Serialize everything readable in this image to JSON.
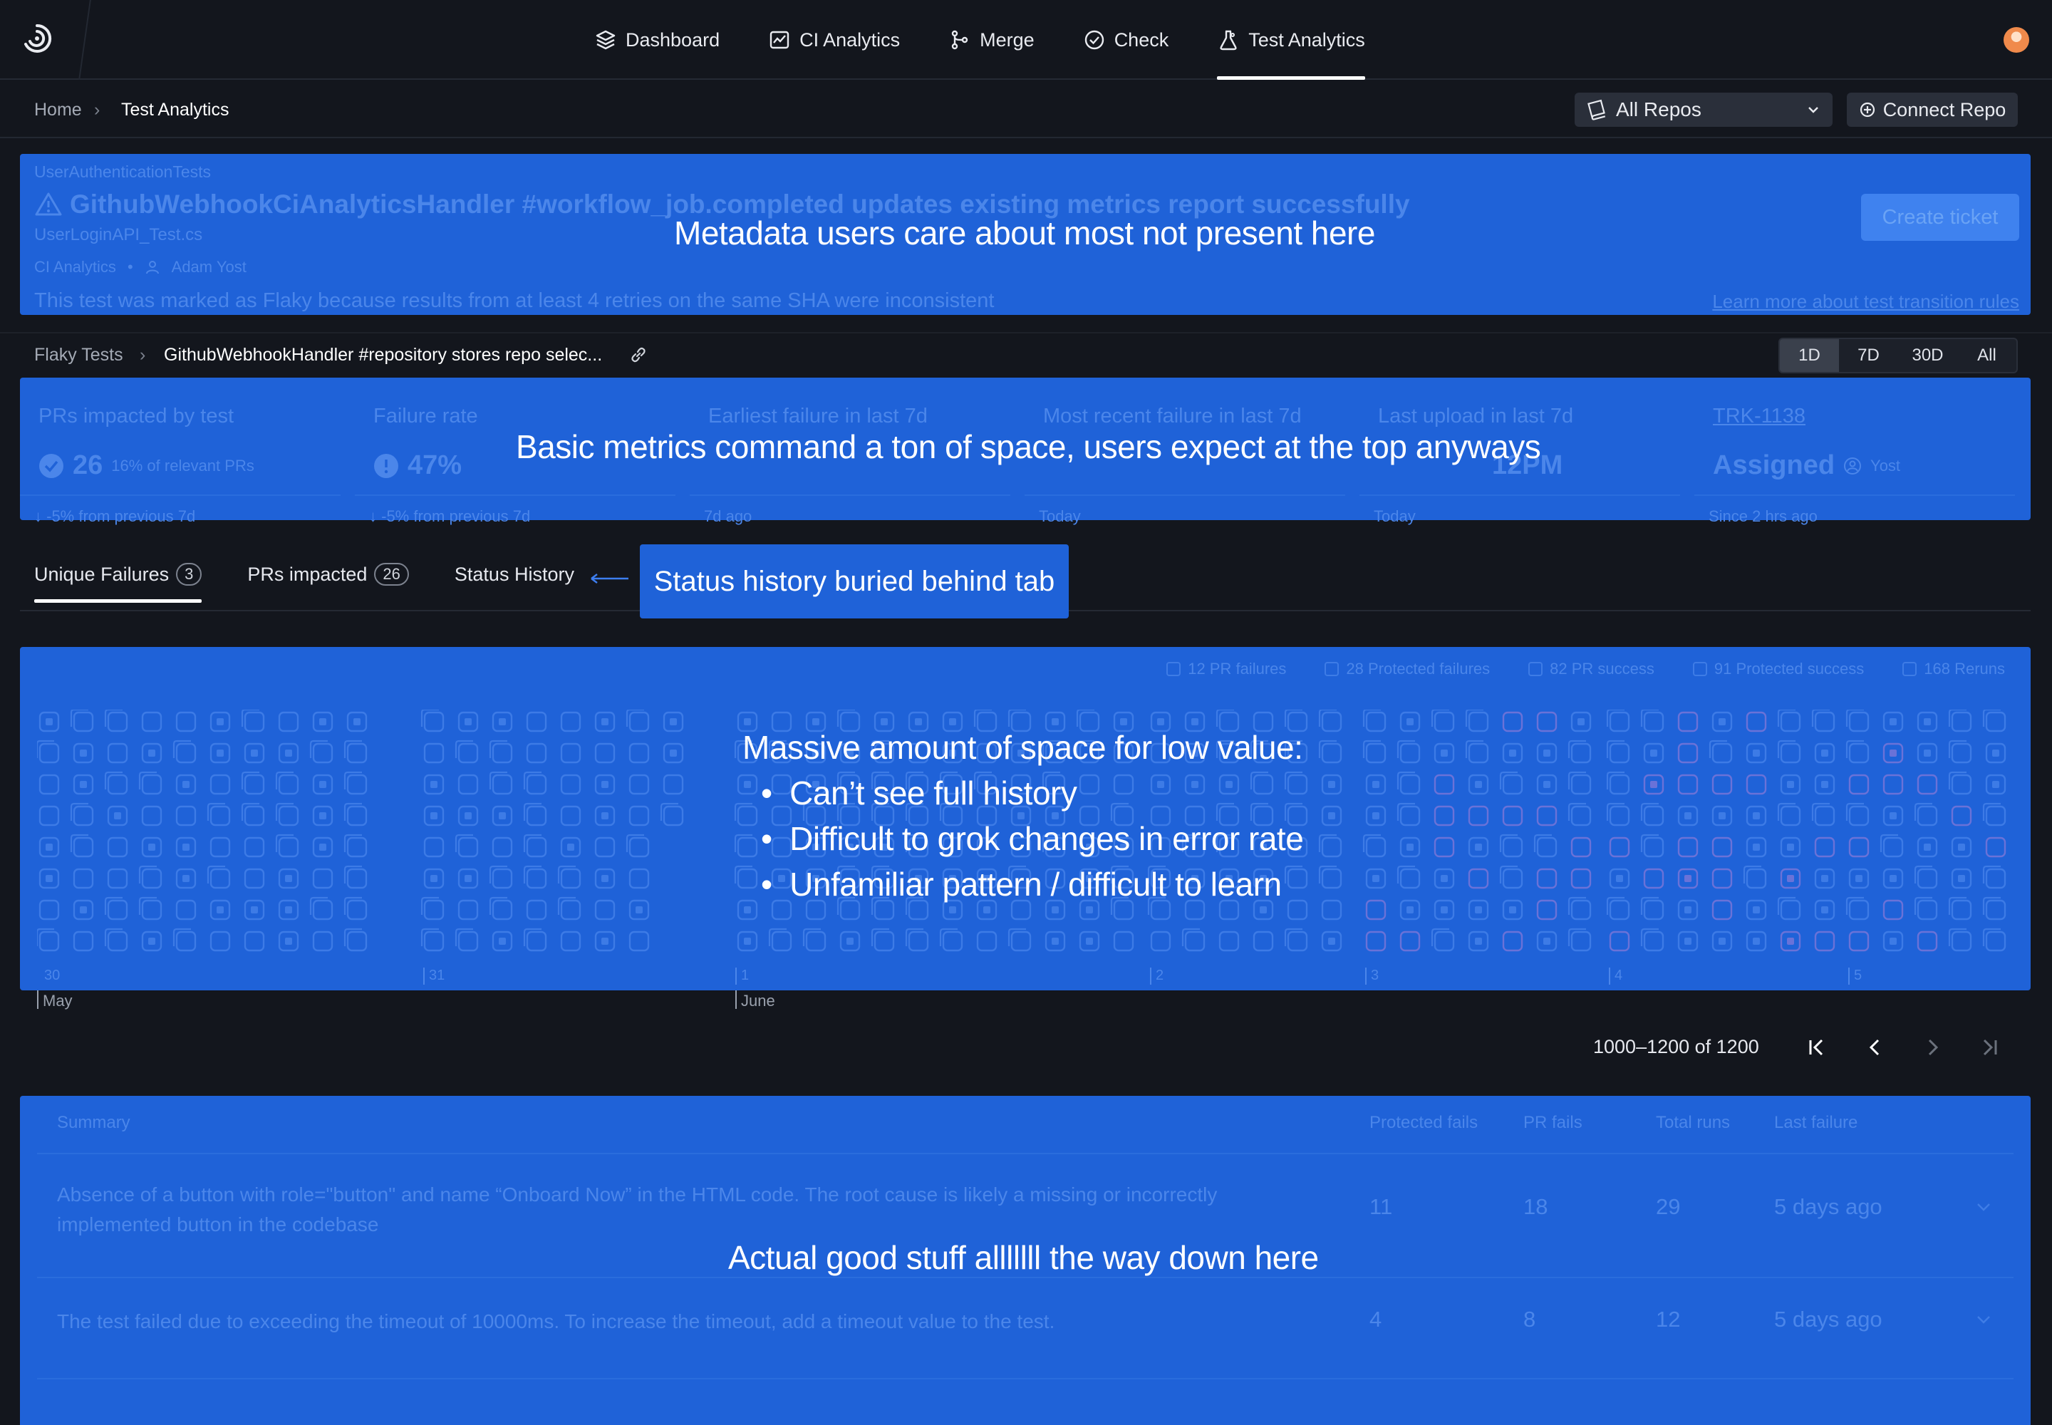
{
  "nav": {
    "items": [
      {
        "label": "Dashboard",
        "icon": "layers-icon"
      },
      {
        "label": "CI Analytics",
        "icon": "chart-line-icon"
      },
      {
        "label": "Merge",
        "icon": "merge-icon"
      },
      {
        "label": "Check",
        "icon": "check-circle-icon"
      },
      {
        "label": "Test Analytics",
        "icon": "flask-icon",
        "active": true
      }
    ]
  },
  "breadcrumb": {
    "home": "Home",
    "current": "Test Analytics"
  },
  "repo_select": {
    "label": "All Repos"
  },
  "connect_repo": {
    "label": "Connect Repo"
  },
  "test_header": {
    "suite": "UserAuthenticationTests",
    "title": "GithubWebhookCiAnalyticsHandler #workflow_job.completed updates existing metrics report successfully",
    "file": "UserLoginAPI_Test.cs",
    "project": "CI Analytics",
    "owner": "Adam Yost",
    "reason": "This test was marked as Flaky because results from at least 4 retries on the same SHA were inconsistent",
    "learn_more": "Learn more about test transition rules",
    "create_ticket": "Create ticket"
  },
  "sub_breadcrumb": {
    "parent": "Flaky Tests",
    "current": "GithubWebhookHandler #repository stores repo selec..."
  },
  "range": {
    "options": [
      "1D",
      "7D",
      "30D",
      "All"
    ],
    "selected": "1D"
  },
  "metrics": [
    {
      "label": "PRs impacted by test",
      "value": "26",
      "sub": "16% of relevant PRs",
      "foot": "-5% from previous 7d"
    },
    {
      "label": "Failure rate",
      "value": "47%",
      "sub": "",
      "foot": "-5% from previous 7d"
    },
    {
      "label": "Earliest failure in last 7d",
      "value": "",
      "sub": "",
      "foot": "7d ago"
    },
    {
      "label": "Most recent failure in last 7d",
      "value": "",
      "sub": "",
      "foot": "Today"
    },
    {
      "label": "Last upload in last 7d",
      "value": "12PM",
      "sub": "",
      "foot": "Today"
    },
    {
      "label": "TRK-1138",
      "value": "Assigned",
      "sub": "Yost",
      "foot": "Since 2 hrs ago"
    }
  ],
  "tabs": [
    {
      "label": "Unique Failures",
      "count": "3",
      "active": true
    },
    {
      "label": "PRs impacted",
      "count": "26"
    },
    {
      "label": "Status History",
      "count": ""
    }
  ],
  "legend": [
    {
      "label": "12 PR failures"
    },
    {
      "label": "28 Protected failures"
    },
    {
      "label": "82 PR success"
    },
    {
      "label": "91 Protected success"
    },
    {
      "label": "168 Reruns"
    }
  ],
  "axis": {
    "days": [
      "30",
      "31",
      "1",
      "2",
      "3",
      "4",
      "5"
    ],
    "months": [
      "May",
      "June"
    ]
  },
  "pagination": {
    "text": "1000–1200 of 1200"
  },
  "table": {
    "headers": {
      "summary": "Summary",
      "protected": "Protected fails",
      "pr": "PR fails",
      "total": "Total runs",
      "last": "Last failure"
    },
    "rows": [
      {
        "summary": "Absence of a button with role=\"button\" and name “Onboard Now” in the HTML code. The root cause is likely a missing or incorrectly implemented button in the codebase",
        "protected": "11",
        "pr": "18",
        "total": "29",
        "last": "5 days ago"
      },
      {
        "summary": "The test failed due to exceeding the timeout of 10000ms. To increase the timeout, add a timeout value to the test.",
        "protected": "4",
        "pr": "8",
        "total": "12",
        "last": "5 days ago"
      }
    ]
  },
  "annotations": {
    "header_note": "Metadata users care about most not present here",
    "metrics_note": "Basic metrics command a ton of space, users expect at the top anyways",
    "tab_note": "Status history buried behind tab",
    "history_title": "Massive amount of space for low value:",
    "history_points": [
      "Can’t see full history",
      "Difficult to grok changes in error rate",
      "Unfamiliar pattern / difficult to learn"
    ],
    "table_note": "Actual good stuff alllllll the way down here"
  }
}
